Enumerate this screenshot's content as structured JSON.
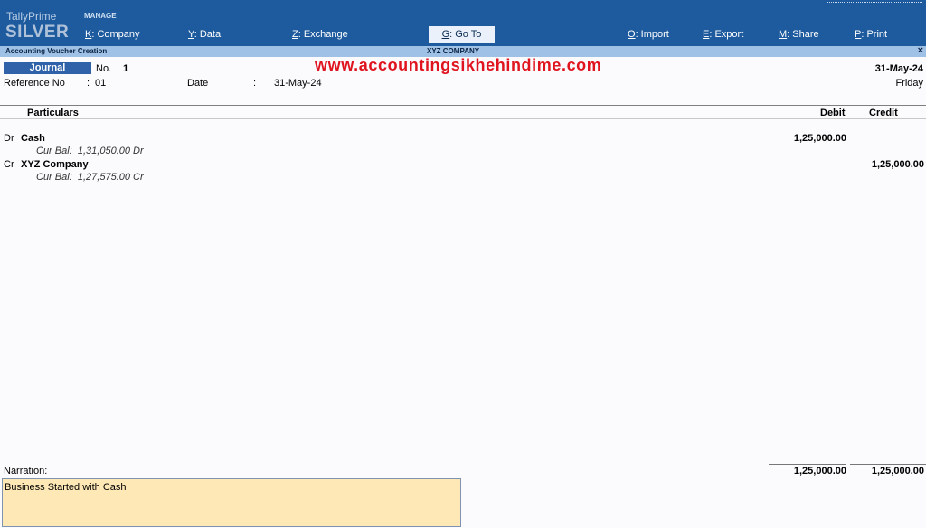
{
  "app": {
    "brand_line1": "TallyPrime",
    "brand_line2": "SILVER"
  },
  "topbar": {
    "manage_label": "MANAGE",
    "menu": [
      {
        "key": "K",
        "rest": ": Company"
      },
      {
        "key": "Y",
        "rest": ": Data"
      },
      {
        "key": "Z",
        "rest": ": Exchange"
      },
      {
        "key": "G",
        "rest": ": Go To"
      },
      {
        "key": "O",
        "rest": ": Import"
      },
      {
        "key": "E",
        "rest": ": Export"
      },
      {
        "key": "M",
        "rest": ": Share"
      },
      {
        "key": "P",
        "rest": ": Print"
      }
    ]
  },
  "subbar": {
    "screen_title": "Accounting Voucher Creation",
    "company": "XYZ COMPANY",
    "close_glyph": "×"
  },
  "voucher": {
    "type": "Journal",
    "no_label": "No.",
    "number": "1",
    "watermark": "www.accountingsikhehindime.com",
    "date_top": "31-May-24",
    "day": "Friday",
    "reference_label": "Reference No",
    "reference_colon": ":",
    "reference_value": "01",
    "date_label": "Date",
    "date_colon": ":",
    "date_value": "31-May-24",
    "columns": {
      "particulars": "Particulars",
      "debit": "Debit",
      "credit": "Credit"
    },
    "entries": [
      {
        "drcr": "Dr",
        "ledger": "Cash",
        "bal_label": "Cur Bal:",
        "bal_value": "1,31,050.00 Dr",
        "debit": "1,25,000.00",
        "credit": ""
      },
      {
        "drcr": "Cr",
        "ledger": "XYZ Company",
        "bal_label": "Cur Bal:",
        "bal_value": "1,27,575.00 Cr",
        "debit": "",
        "credit": "1,25,000.00"
      }
    ],
    "narration_label": "Narration:",
    "narration": "Business Started with Cash",
    "total_debit": "1,25,000.00",
    "total_credit": "1,25,000.00"
  },
  "colors": {
    "topbar": "#1e5b9e",
    "subbar": "#9fc1e6",
    "voucher_type_bg": "#2f62a8",
    "watermark": "#e0141e",
    "narration_bg": "#fde8b6"
  }
}
